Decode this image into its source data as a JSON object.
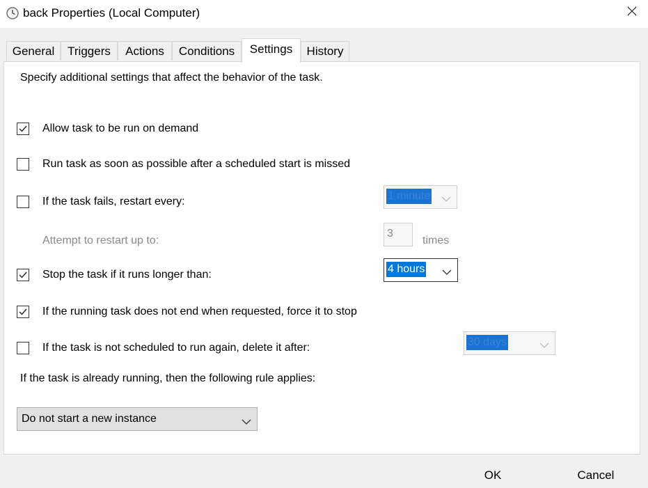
{
  "window": {
    "title": "back Properties (Local Computer)",
    "icon": "clock-icon",
    "close_icon": "close-icon"
  },
  "tabs": [
    {
      "label": "General",
      "active": false
    },
    {
      "label": "Triggers",
      "active": false
    },
    {
      "label": "Actions",
      "active": false
    },
    {
      "label": "Conditions",
      "active": false
    },
    {
      "label": "Settings",
      "active": true
    },
    {
      "label": "History",
      "active": false
    }
  ],
  "settings": {
    "intro": "Specify additional settings that affect the behavior of the task.",
    "allow_on_demand": {
      "label": "Allow task to be run on demand",
      "checked": true
    },
    "run_missed": {
      "label": "Run task as soon as possible after a scheduled start is missed",
      "checked": false
    },
    "restart_on_fail": {
      "label": "If the task fails, restart every:",
      "checked": false,
      "interval": "1 minute"
    },
    "restart_attempts": {
      "label": "Attempt to restart up to:",
      "value": "3",
      "suffix": "times"
    },
    "stop_if_longer": {
      "label": "Stop the task if it runs longer than:",
      "checked": true,
      "duration": "4 hours"
    },
    "force_stop": {
      "label": "If the running task does not end when requested, force it to stop",
      "checked": true
    },
    "delete_after": {
      "label": "If the task is not scheduled to run again, delete it after:",
      "checked": false,
      "duration": "30 days"
    },
    "rule_label": "If the task is already running, then the following rule applies:",
    "rule_value": "Do not start a new instance"
  },
  "buttons": {
    "ok": "OK",
    "cancel": "Cancel"
  },
  "colors": {
    "selection": "#0078d7",
    "panel": "#ffffff",
    "window": "#f0f0f0"
  }
}
